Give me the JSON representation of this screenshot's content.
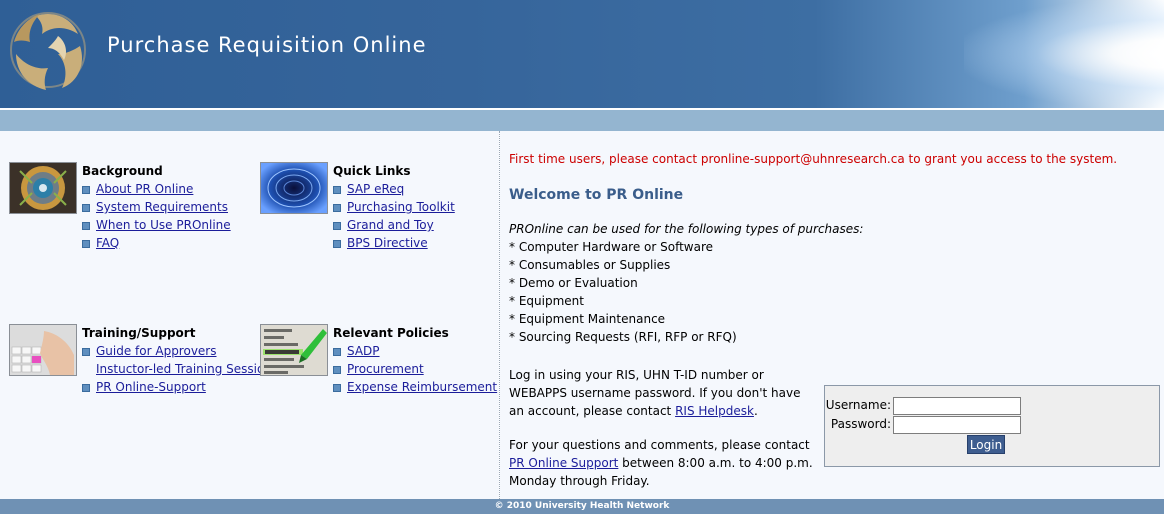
{
  "header": {
    "title": "Purchase Requisition Online"
  },
  "left": {
    "background": {
      "title": "Background",
      "links": [
        "About PR Online",
        "System Requirements",
        "When to Use PROnline",
        "FAQ"
      ]
    },
    "quick_links": {
      "title": "Quick Links",
      "links": [
        "SAP eReq",
        "Purchasing Toolkit",
        "Grand and Toy",
        "BPS Directive"
      ]
    },
    "training": {
      "title": "Training/Support",
      "links": [
        "Guide for Approvers",
        "Instuctor-led Training Sessions",
        "PR Online-Support"
      ]
    },
    "policies": {
      "title": "Relevant Policies",
      "links": [
        "SADP",
        "Procurement",
        "Expense Reimbursement"
      ]
    }
  },
  "right": {
    "notice": "First time users, please contact pronline-support@uhnresearch.ca to grant you access to the system.",
    "welcome": "Welcome to PR Online",
    "purpose_intro": "PROnline can be used for the following types of purchases:",
    "purposes": [
      "* Computer Hardware or Software",
      "* Consumables or Supplies",
      "* Demo or Evaluation",
      "* Equipment",
      "* Equipment Maintenance",
      "* Sourcing Requests (RFI, RFP or RFQ)"
    ],
    "login_info_text": "Log in using your RIS, UHN T-ID number or WEBAPPS username password. If you don't have an account, please contact ",
    "login_info_link": "RIS Helpdesk",
    "login_info_end": ".",
    "contact_text": "For your questions and comments, please contact ",
    "contact_link": "PR Online Support",
    "contact_end": " between 8:00 a.m. to 4:00 p.m. Monday through Friday."
  },
  "login": {
    "username_label": "Username:",
    "password_label": "Password:",
    "username_value": "",
    "password_value": "",
    "button_label": "Login"
  },
  "footer": {
    "text": "© 2010 University Health Network"
  },
  "colors": {
    "header_blue": "#36659b",
    "subbar": "#94b5d0",
    "notice_red": "#cc0000",
    "link_blue": "#1b1d9a",
    "footer": "#6f91b4"
  }
}
